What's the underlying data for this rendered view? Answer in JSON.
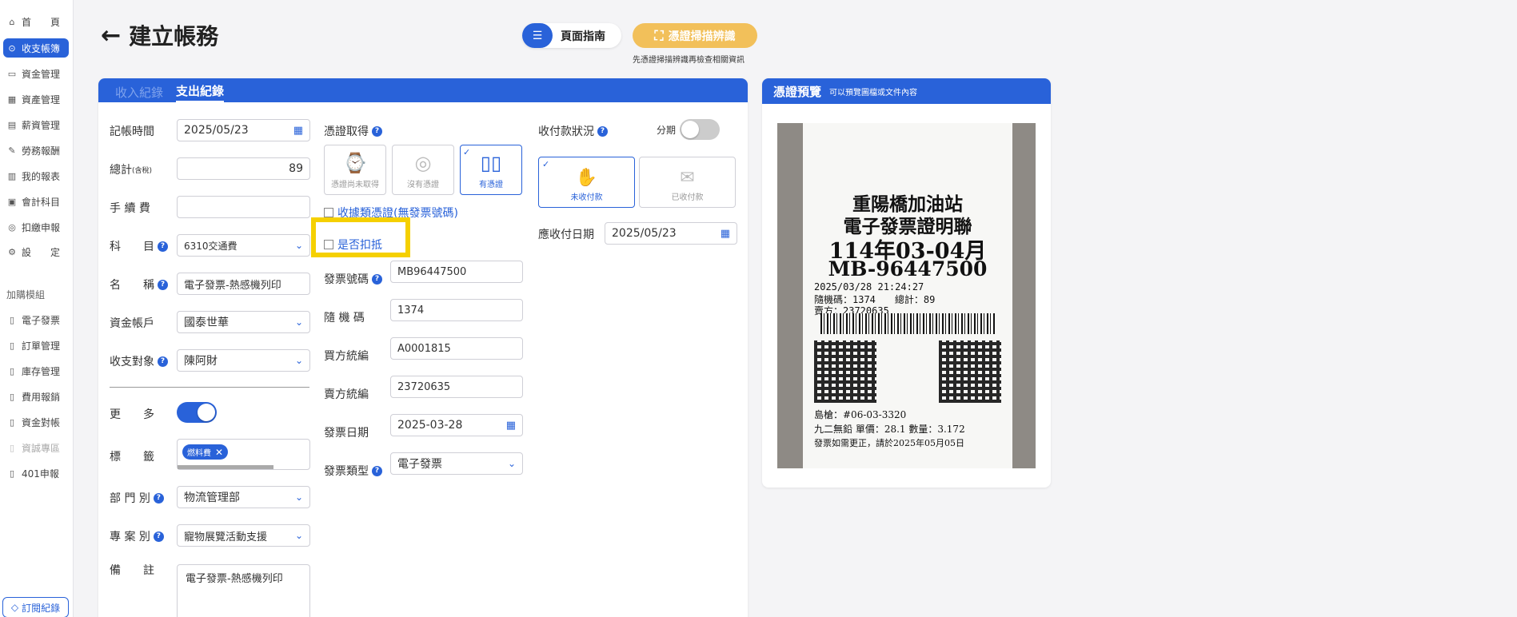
{
  "sidebar": {
    "items": [
      {
        "label": "首　　頁",
        "icon": "home-icon"
      },
      {
        "label": "收支帳簿",
        "icon": "ledger-icon"
      },
      {
        "label": "資金管理",
        "icon": "wallet-icon"
      },
      {
        "label": "資產管理",
        "icon": "asset-icon"
      },
      {
        "label": "薪資管理",
        "icon": "salary-icon"
      },
      {
        "label": "勞務報酬",
        "icon": "labor-icon"
      },
      {
        "label": "我的報表",
        "icon": "report-icon"
      },
      {
        "label": "會計科目",
        "icon": "accounts-icon"
      },
      {
        "label": "扣繳申報",
        "icon": "withholding-icon"
      },
      {
        "label": "設　　定",
        "icon": "settings-icon"
      }
    ],
    "group_label": "加購模組",
    "modules": [
      {
        "label": "電子發票"
      },
      {
        "label": "訂單管理"
      },
      {
        "label": "庫存管理"
      },
      {
        "label": "費用報銷"
      },
      {
        "label": "資金對帳"
      },
      {
        "label": "資誠專區"
      },
      {
        "label": "401申報"
      }
    ],
    "subscribe_label": "訂閱紀錄"
  },
  "header": {
    "title": "建立帳務",
    "guide_label": "頁面指南",
    "scan_label": "憑證掃描辨識",
    "scan_hint": "先憑證掃描辨識再檢查相關資訊"
  },
  "tabs": [
    "收入紀錄",
    "支出紀錄"
  ],
  "form": {
    "date_label": "記帳時間",
    "date_value": "2025/05/23",
    "total_label": "總計",
    "total_sub": "(含稅)",
    "total_value": "89",
    "fee_label": "手 續 費",
    "fee_value": "",
    "subject_label": "科　　目",
    "subject_value": "6310交通費",
    "name_label": "名　　稱",
    "name_value": "電子發票-熱感機列印",
    "account_label": "資金帳戶",
    "account_value": "國泰世華",
    "target_label": "收支對象",
    "target_value": "陳阿財",
    "more_label": "更　　多",
    "tag_label": "標　　籤",
    "tag_chip": "燃料費",
    "dept_label": "部 門 別",
    "dept_value": "物流管理部",
    "project_label": "專 案 別",
    "project_value": "寵物展覽活動支援",
    "note_label": "備　　註",
    "note_value": "電子發票-熱感機列印"
  },
  "voucher": {
    "label": "憑證取得",
    "options": [
      "憑證尚未取得",
      "沒有憑證",
      "有憑證"
    ],
    "receipt_type_label": "收據類憑證(無發票號碼)",
    "deduct_label": "是否扣抵",
    "invoice_no_label": "發票號碼",
    "invoice_no": "MB96447500",
    "random_label": "隨 機 碼",
    "random_code": "1374",
    "buyer_label": "買方統編",
    "buyer_id": "A0001815",
    "seller_label": "賣方統編",
    "seller_id": "23720635",
    "invoice_date_label": "發票日期",
    "invoice_date": "2025-03-28",
    "invoice_type_label": "發票類型",
    "invoice_type": "電子發票"
  },
  "payment": {
    "status_label": "收付款狀況",
    "installment_label": "分期",
    "options": [
      "未收付款",
      "已收付款"
    ],
    "due_label": "應收付日期",
    "due_date": "2025/05/23"
  },
  "preview": {
    "title": "憑證預覽",
    "subtitle": "可以預覽圖檔或文件內容",
    "receipt": {
      "line1": "重陽橋加油站",
      "line2": "電子發票證明聯",
      "line3": "114年03-04月",
      "line4": "MB-96447500",
      "datetime": "2025/03/28 21:24:27",
      "random": "隨機碼：1374　　總計：89",
      "seller": "賣方：23720635",
      "pump": "島槍：#06-03-3320",
      "item": "九二無鉛 單價：28.1 數量：3.172",
      "footer": "發票如需更正，請於2025年05月05日"
    }
  },
  "colors": {
    "primary": "#2962d9",
    "accent": "#f2c05a",
    "highlight": "#f5d000"
  }
}
